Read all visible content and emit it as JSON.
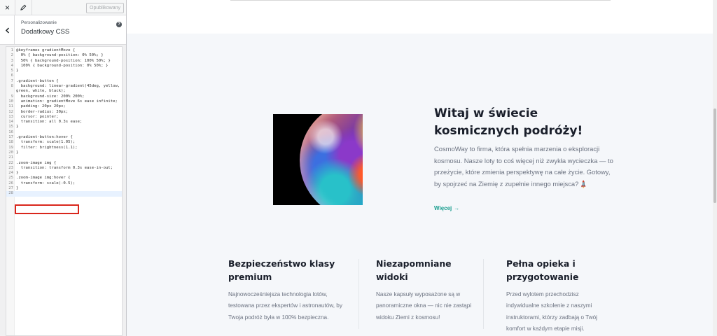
{
  "sidebar": {
    "close_icon": "×",
    "publish_label": "Opublikowany",
    "breadcrumb": "Personalizowanie",
    "section_title": "Dodatkowy CSS",
    "help_icon": "?",
    "code_lines": [
      {
        "n": "1",
        "t": "@keyframes gradientMove {"
      },
      {
        "n": "2",
        "t": "  0% { background-position: 0% 50%; }"
      },
      {
        "n": "3",
        "t": "  50% { background-position: 100% 50%; }"
      },
      {
        "n": "4",
        "t": "  100% { background-position: 0% 50%; }"
      },
      {
        "n": "5",
        "t": "}"
      },
      {
        "n": "6",
        "t": ""
      },
      {
        "n": "7",
        "t": ".gradient-button {"
      },
      {
        "n": "8",
        "t": "  background: linear-gradient(45deg, yellow,"
      },
      {
        "n": "",
        "t": "green, white, black);"
      },
      {
        "n": "9",
        "t": "  background-size: 200% 200%;"
      },
      {
        "n": "10",
        "t": "  animation: gradientMove 6s ease infinite;"
      },
      {
        "n": "11",
        "t": "  padding: 20px 20px;"
      },
      {
        "n": "12",
        "t": "  border-radius: 30px;"
      },
      {
        "n": "13",
        "t": "  cursor: pointer;"
      },
      {
        "n": "14",
        "t": "  transition: all 0.3s ease;"
      },
      {
        "n": "15",
        "t": "}"
      },
      {
        "n": "16",
        "t": ""
      },
      {
        "n": "17",
        "t": ".gradient-button:hover {"
      },
      {
        "n": "18",
        "t": "  transform: scale(1.05);"
      },
      {
        "n": "19",
        "t": "  filter: brightness(1.1);"
      },
      {
        "n": "20",
        "t": "}"
      },
      {
        "n": "21",
        "t": ""
      },
      {
        "n": "22",
        "t": ".zoom-image img {"
      },
      {
        "n": "23",
        "t": "  transition: transform 0.3s ease-in-out;"
      },
      {
        "n": "24",
        "t": "}"
      },
      {
        "n": "25",
        "t": ".zoom-image img:hover {"
      },
      {
        "n": "26",
        "t": "  transform: scale(-0.5);"
      },
      {
        "n": "27",
        "t": "}"
      },
      {
        "n": "28",
        "t": ""
      }
    ]
  },
  "hero": {
    "title": "Witaj w świecie kosmicznych podróży!",
    "text": "CosmoWay to firma, która spełnia marzenia o eksploracji kosmosu. Nasze loty to coś więcej niż zwykła wycieczka — to przeżycie, które zmienia perspektywę na całe życie. Gotowy, by spojrzeć na Ziemię z zupełnie innego miejsca?",
    "rocket_icon": "🚀",
    "more_label": "Więcej",
    "arrow_icon": "→"
  },
  "features": [
    {
      "title": "Bezpieczeństwo klasy premium",
      "text": "Najnowocześniejsza technologia lotów, testowana przez ekspertów i astronautów, by Twoja podróż była w 100% bezpieczna."
    },
    {
      "title": "Niezapomniane widoki",
      "text": "Nasze kapsuły wyposażone są w panoramiczne okna — nic nie zastąpi widoku Ziemi z kosmosu!"
    },
    {
      "title": "Pełna opieka i przygotowanie",
      "text": "Przed wylotem przechodzisz indywidualne szkolenie z naszymi instruktorami, którzy zadbają o Twój komfort w każdym etapie misji."
    }
  ]
}
